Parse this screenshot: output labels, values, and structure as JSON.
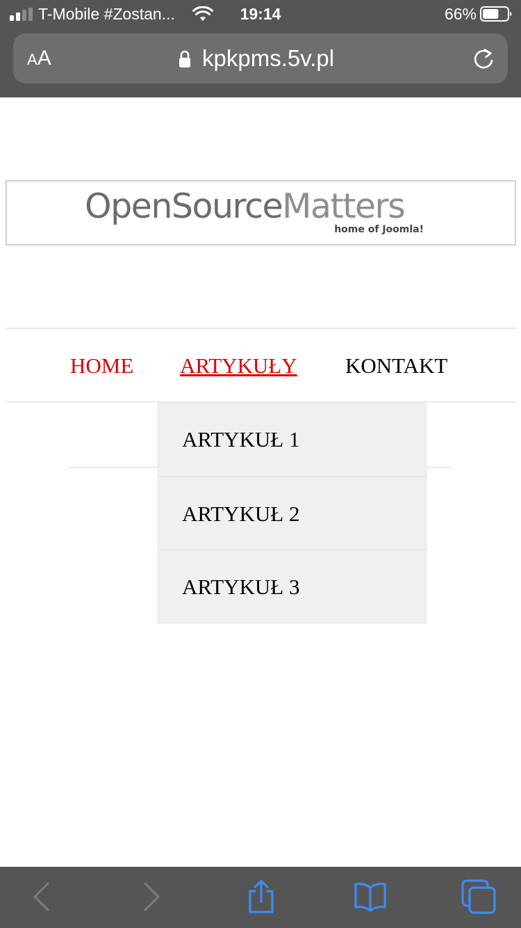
{
  "status_bar": {
    "carrier": "T-Mobile #Zostan...",
    "time": "19:14",
    "battery_percent": "66%",
    "battery_level": 0.66,
    "signal_bars": 2,
    "icons": [
      "signal-icon",
      "wifi-icon",
      "battery-icon"
    ]
  },
  "url_bar": {
    "text_size_label_small": "A",
    "text_size_label_large": "A",
    "url": "kpkpms.5v.pl",
    "icons": [
      "lock-icon",
      "reload-icon"
    ]
  },
  "banner": {
    "logo_dark": "OpenSource",
    "logo_light": "Matters",
    "tagline": "home of Joomla!"
  },
  "nav": {
    "items": [
      {
        "label": "HOME",
        "active": false
      },
      {
        "label": "ARTYKUŁY",
        "active": true
      },
      {
        "label": "KONTAKT",
        "active": false
      }
    ],
    "link_color": "#dd0000"
  },
  "dropdown": {
    "items": [
      {
        "label": "ARTYKUŁ 1"
      },
      {
        "label": "ARTYKUŁ 2"
      },
      {
        "label": "ARTYKUŁ 3"
      }
    ]
  },
  "toolbar": {
    "icons": [
      "back-arrow-icon",
      "forward-arrow-icon",
      "share-icon",
      "bookmarks-icon",
      "tabs-icon"
    ],
    "accent": "#3d8cf5",
    "disabled": "#7a7a7a"
  }
}
